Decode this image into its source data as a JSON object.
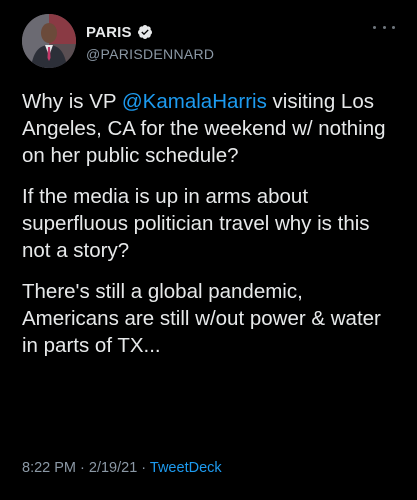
{
  "colors": {
    "background": "#000000",
    "text": "#e7e9ea",
    "secondary": "#8b98a5",
    "link": "#1d9bf0",
    "verified_badge": "#e7e9ea"
  },
  "author": {
    "display_name": "PARIS",
    "handle": "@PARISDENNARD",
    "verified": true,
    "verified_icon": "verified-badge-icon",
    "avatar_icon": "avatar-image"
  },
  "menu": {
    "icon": "more-options-icon"
  },
  "tweet": {
    "p1_before": "Why is VP ",
    "p1_mention": "@KamalaHarris",
    "p1_after": " visiting Los Angeles, CA for the weekend w/ nothing on her public schedule?",
    "p2": "If the media is up in arms about superfluous politician travel why is this not a story?",
    "p3": "There's still a global pandemic, Americans are still w/out power & water in parts of TX..."
  },
  "meta": {
    "time": "8:22 PM",
    "sep1": " · ",
    "date": "2/19/21",
    "sep2": " · ",
    "source": "TweetDeck"
  }
}
